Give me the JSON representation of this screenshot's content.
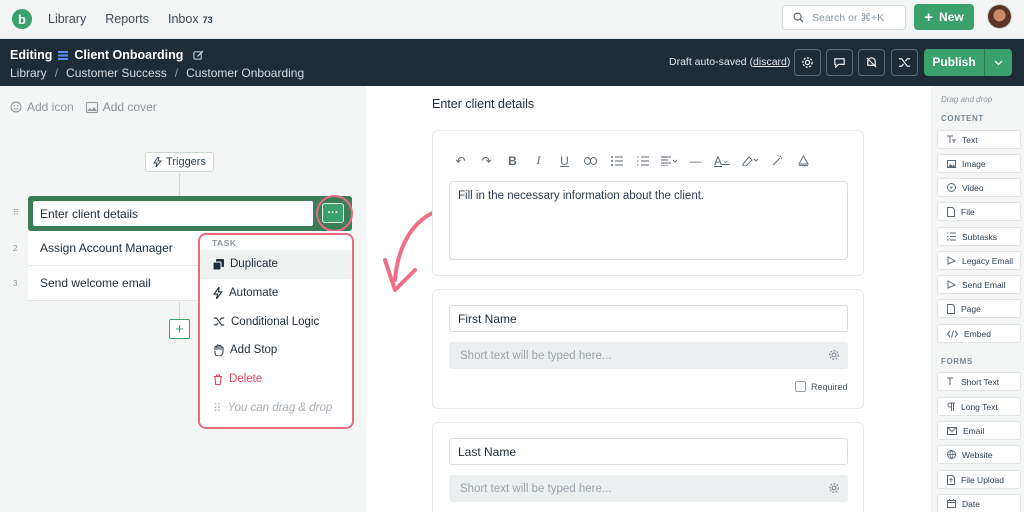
{
  "app": {
    "logo_letter": "b",
    "nav": [
      {
        "label": "Library"
      },
      {
        "label": "Reports"
      },
      {
        "label": "Inbox",
        "badge": "73"
      }
    ],
    "search_placeholder": "Search or ⌘+K",
    "new_button": "New"
  },
  "header": {
    "editing_label": "Editing",
    "doc_name": "Client Onboarding",
    "breadcrumbs": [
      "Library",
      "Customer Success",
      "Customer Onboarding"
    ],
    "draft_text": "Draft auto-saved",
    "discard_label": "discard",
    "publish_label": "Publish"
  },
  "left": {
    "add_icon": "Add icon",
    "add_cover": "Add cover",
    "triggers": "Triggers",
    "tasks": [
      {
        "title": "Enter client details"
      },
      {
        "num": "2",
        "title": "Assign Account Manager"
      },
      {
        "num": "3",
        "title": "Send welcome email"
      }
    ],
    "menu": {
      "header": "TASK",
      "items": [
        "Duplicate",
        "Automate",
        "Conditional Logic",
        "Add Stop",
        "Delete",
        "You can drag & drop"
      ]
    }
  },
  "editor": {
    "title": "Enter client details",
    "body_text": "Fill in the necessary information about the client.",
    "fields": [
      {
        "label": "First Name",
        "placeholder": "Short text will be typed here...",
        "required_label": "Required"
      },
      {
        "label": "Last Name",
        "placeholder": "Short text will be typed here..."
      }
    ]
  },
  "sidebar": {
    "drag_hint": "Drag and drop",
    "content_header": "CONTENT",
    "content_items": [
      "Text",
      "Image",
      "Video",
      "File",
      "Subtasks",
      "Legacy Email",
      "Send Email",
      "Page",
      "Embed"
    ],
    "forms_header": "FORMS",
    "form_items": [
      "Short Text",
      "Long Text",
      "Email",
      "Website",
      "File Upload",
      "Date"
    ]
  },
  "colors": {
    "brand_green": "#3aa06c",
    "dark_header": "#1e2c37",
    "highlight_pink": "#e96b7f"
  }
}
